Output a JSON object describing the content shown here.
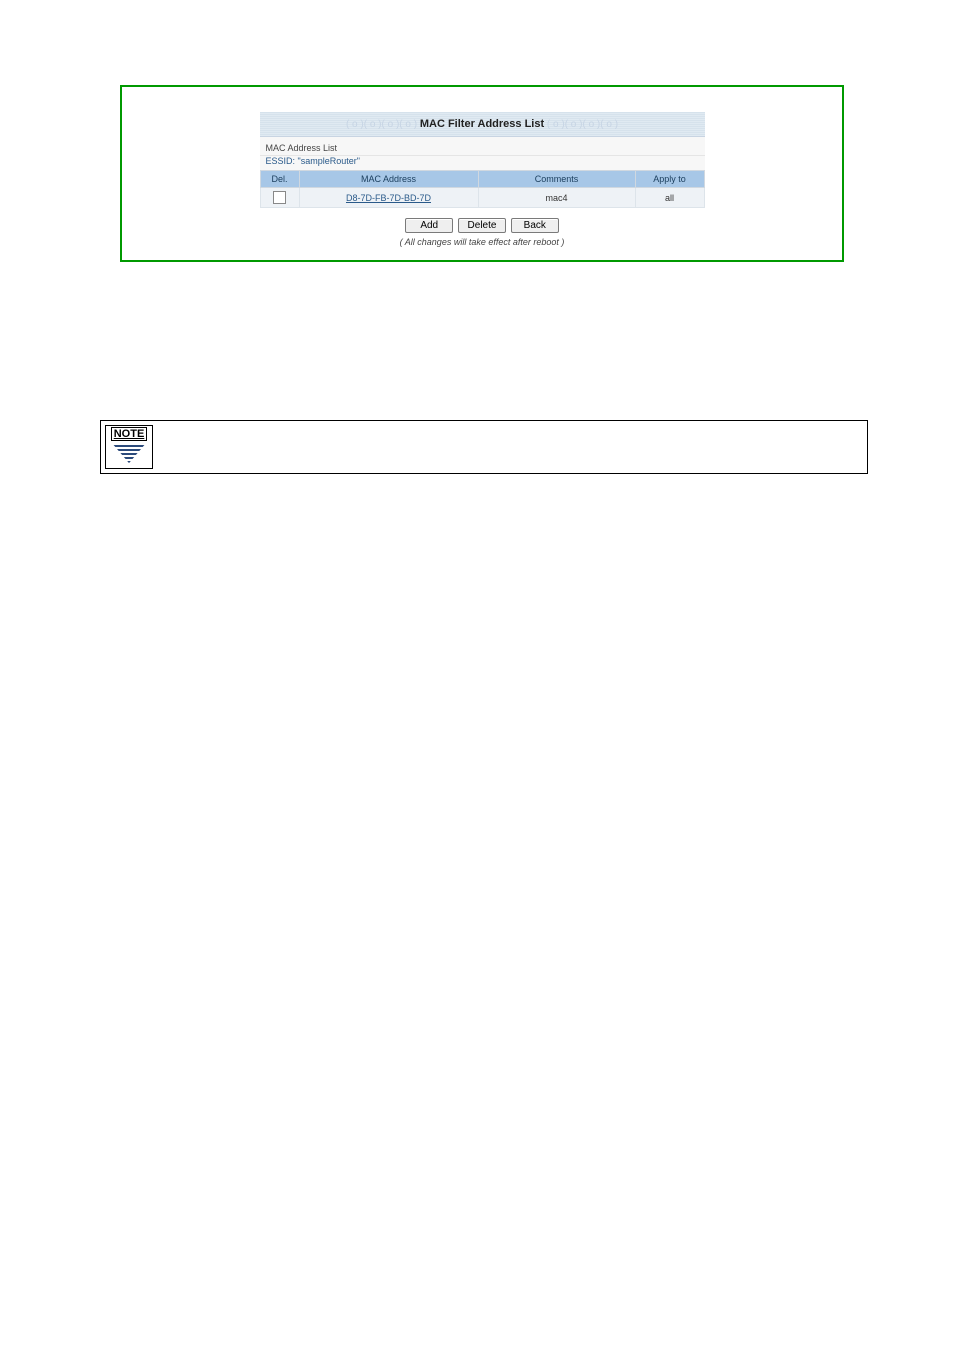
{
  "panel": {
    "title": "MAC Filter Address List",
    "section_label": "MAC Address List",
    "essid_label": "ESSID: \"sampleRouter\"",
    "headers": {
      "del": "Del.",
      "mac": "MAC Address",
      "comments": "Comments",
      "apply": "Apply to"
    },
    "rows": [
      {
        "mac": "D8-7D-FB-7D-BD-7D",
        "comments": "mac4",
        "apply": "all"
      }
    ],
    "buttons": {
      "add": "Add",
      "delete": "Delete",
      "back": "Back"
    },
    "reboot_note": "( All changes will take effect after reboot )"
  },
  "note": {
    "label": "NOTE",
    "text": ""
  }
}
